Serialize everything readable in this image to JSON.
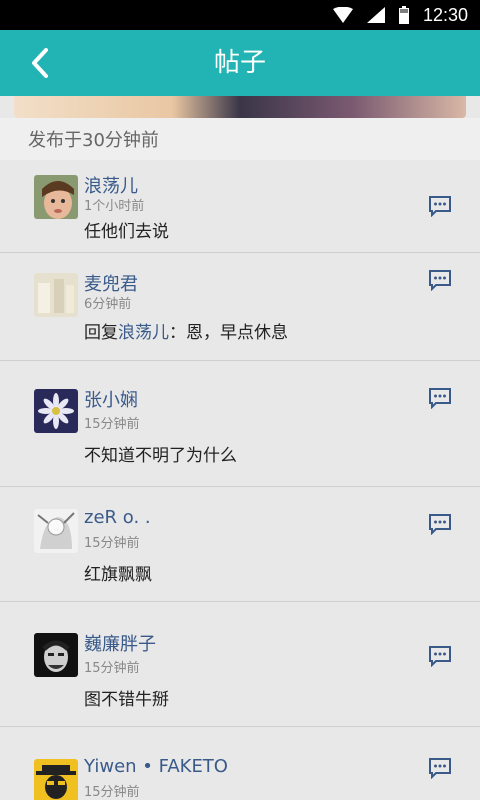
{
  "statusbar": {
    "time": "12:30"
  },
  "appbar": {
    "title": "帖子"
  },
  "post": {
    "time_label": "发布于30分钟前"
  },
  "comments": [
    {
      "name": "浪荡儿",
      "time": "1个小时前",
      "text": "任他们去说"
    },
    {
      "name": "麦兜君",
      "time": "6分钟前",
      "reply_prefix": "回复",
      "mention": "浪荡儿",
      "text": "：恩，早点休息"
    },
    {
      "name": "张小娴",
      "time": "15分钟前",
      "text": "不知道不明了为什么"
    },
    {
      "name": "zeR o. .",
      "time": "15分钟前",
      "text": "红旗飘飘"
    },
    {
      "name": "巍廉胖子",
      "time": "15分钟前",
      "text": "图不错牛掰"
    },
    {
      "name": "Yiwen • FAKETO",
      "time": "15分钟前",
      "text": ""
    }
  ],
  "colors": {
    "appbar": "#22b4b4",
    "name": "#3a5a8a",
    "reply_icon": "#3a5a8a"
  },
  "icons": {
    "back": "chevron-left-icon",
    "reply": "comment-bubble-icon"
  }
}
